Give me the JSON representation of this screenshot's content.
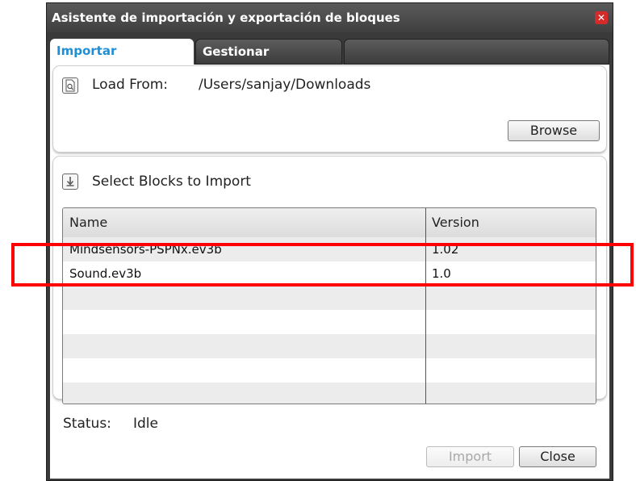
{
  "window": {
    "title": "Asistente de importación y exportación de bloques"
  },
  "tabs": [
    {
      "label": "Importar"
    },
    {
      "label": "Gestionar"
    }
  ],
  "load_from": {
    "label": "Load From:",
    "path": "/Users/sanjay/Downloads",
    "browse_label": "Browse"
  },
  "select_blocks": {
    "label": "Select Blocks to Import",
    "columns": [
      "Name",
      "Version"
    ],
    "rows": [
      {
        "name": "Mindsensors-PSPNx.ev3b",
        "version": "1.02"
      },
      {
        "name": "Sound.ev3b",
        "version": "1.0"
      }
    ]
  },
  "status": {
    "label": "Status:",
    "value": "Idle"
  },
  "buttons": {
    "import_label": "Import",
    "close_label": "Close"
  },
  "colors": {
    "accent": "#1e8fd6",
    "highlight": "#ff0000",
    "close_red": "#d42a2a"
  }
}
